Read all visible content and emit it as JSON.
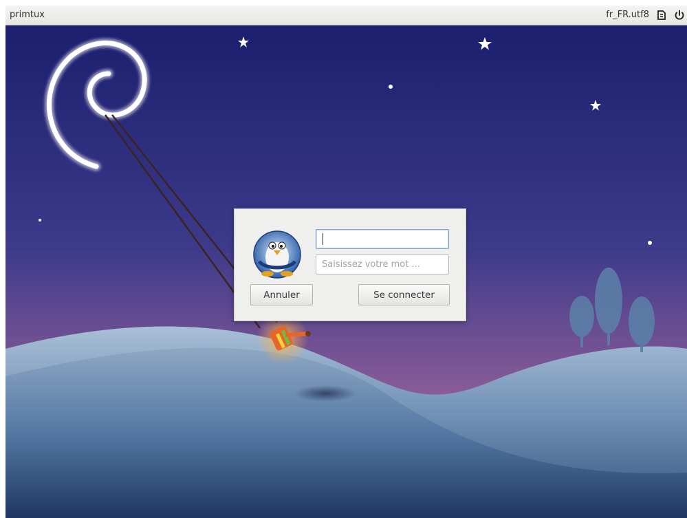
{
  "topbar": {
    "hostname": "primtux",
    "locale": "fr_FR.utf8",
    "session_icon": "session-icon",
    "power_icon": "power-icon"
  },
  "login": {
    "username_value": "",
    "password_placeholder": "Saisissez votre mot ...",
    "cancel_label": "Annuler",
    "login_label": "Se connecter",
    "avatar_icon": "penguin-avatar"
  },
  "colors": {
    "sky_top": "#1b1f6e",
    "sky_bottom": "#8a5c98",
    "hills": "#5a7aa0",
    "dialog_bg": "#efefed",
    "field_focus": "#7ea6d6"
  }
}
